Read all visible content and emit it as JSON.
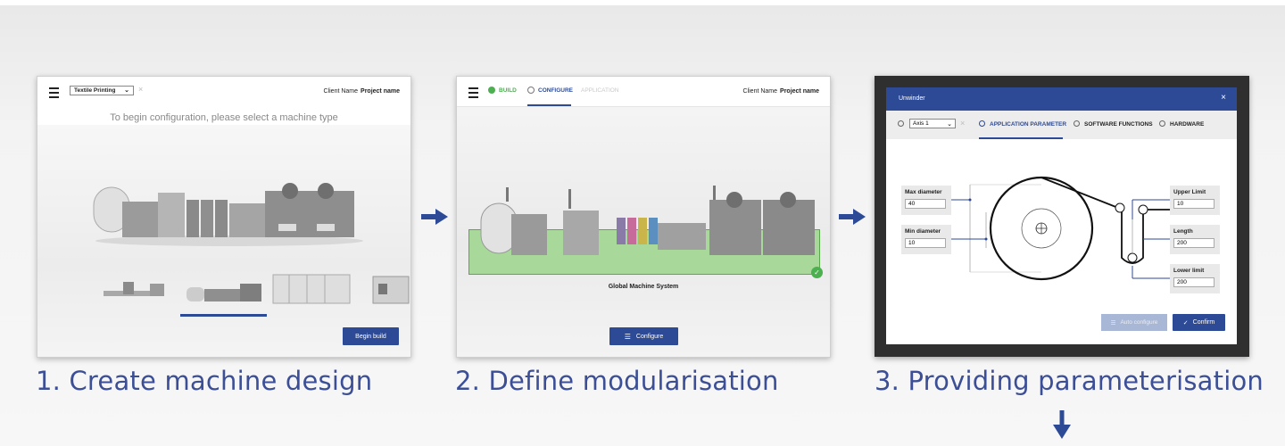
{
  "colors": {
    "brand_blue": "#2d4a96",
    "caption_blue": "#3c4f96",
    "success_green": "#4caf50",
    "module_highlight": "#a8d99a"
  },
  "steps": [
    {
      "caption": "1. Create machine design",
      "screen": {
        "menu_icon": "hamburger-icon",
        "machine_type_select": "Textile Printing",
        "client_label": "Client Name",
        "project_label": "Project name",
        "prompt": "To begin configuration, please select a machine type",
        "begin_button": "Begin build"
      }
    },
    {
      "caption": "2. Define modularisation",
      "screen": {
        "menu_icon": "hamburger-icon",
        "tabs": [
          {
            "label": "BUILD",
            "state": "done"
          },
          {
            "label": "CONFIGURE",
            "state": "active"
          },
          {
            "label": "APPLICATION",
            "state": "disabled"
          }
        ],
        "client_label": "Client Name",
        "project_label": "Project name",
        "module_label": "Global Machine System",
        "configure_button": "Configure"
      }
    },
    {
      "caption": "3. Providing parameterisation",
      "screen": {
        "dialog_title": "Unwinder",
        "axis_select": "Axis 1",
        "tabs": [
          "APPLICATION PARAMETER",
          "SOFTWARE FUNCTIONS",
          "HARDWARE"
        ],
        "params": [
          {
            "label": "Max diameter",
            "value": "40"
          },
          {
            "label": "Min diameter",
            "value": "10"
          },
          {
            "label": "Upper Limit",
            "value": "10"
          },
          {
            "label": "Length",
            "value": "200"
          },
          {
            "label": "Lower limit",
            "value": "200"
          }
        ],
        "auto_configure_button": "Auto configure",
        "confirm_button": "Confirm"
      }
    }
  ]
}
